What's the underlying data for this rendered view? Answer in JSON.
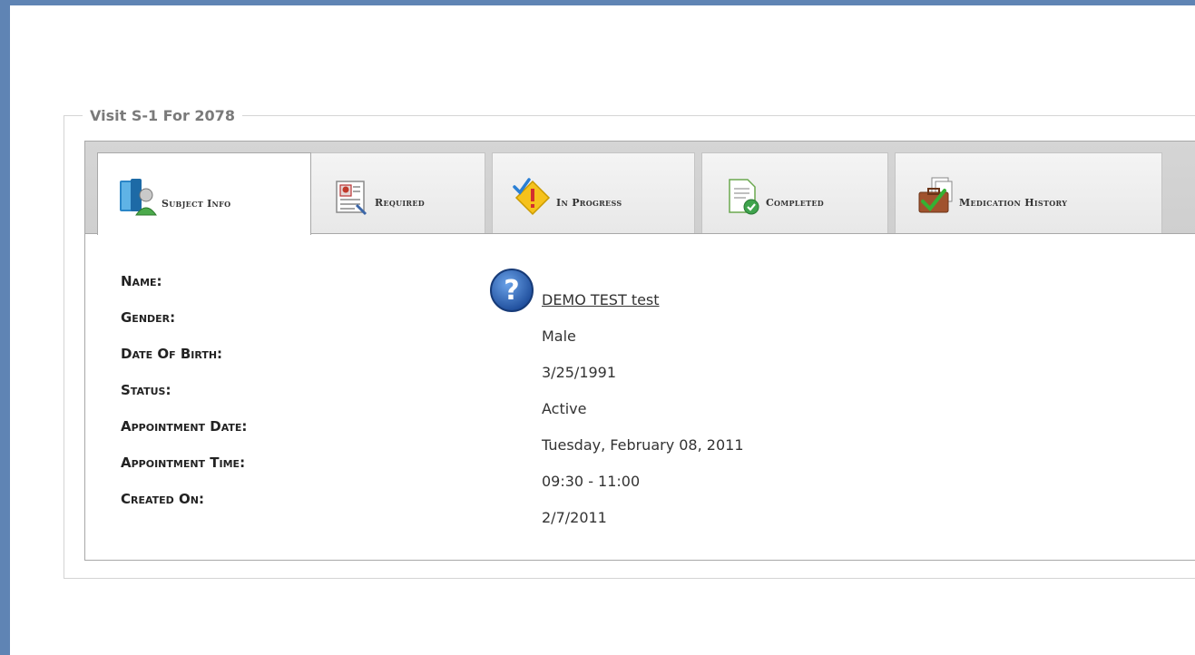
{
  "visit": {
    "legend": "Visit S-1 For 2078"
  },
  "tabs": [
    {
      "label": "Subject Info",
      "icon": "subject-info-icon",
      "active": true
    },
    {
      "label": "Required",
      "icon": "required-icon",
      "active": false
    },
    {
      "label": "In Progress",
      "icon": "in-progress-icon",
      "active": false
    },
    {
      "label": "Completed",
      "icon": "completed-icon",
      "active": false
    },
    {
      "label": "Medication History",
      "icon": "medication-history-icon",
      "active": false
    }
  ],
  "subject": {
    "labels": {
      "name": "Name:",
      "gender": "Gender:",
      "dob": "Date Of Birth:",
      "status": "Status:",
      "appt_date": "Appointment Date:",
      "appt_time": "Appointment Time:",
      "created_on": "Created On:"
    },
    "values": {
      "name": "DEMO TEST test",
      "gender": "Male",
      "dob": "3/25/1991",
      "status": "Active",
      "appt_date": "Tuesday, February 08, 2011",
      "appt_time": "09:30 - 11:00",
      "created_on": "2/7/2011"
    }
  },
  "colors": {
    "frame": "#5f84b4",
    "tab_strip": "#d5d5d5"
  }
}
